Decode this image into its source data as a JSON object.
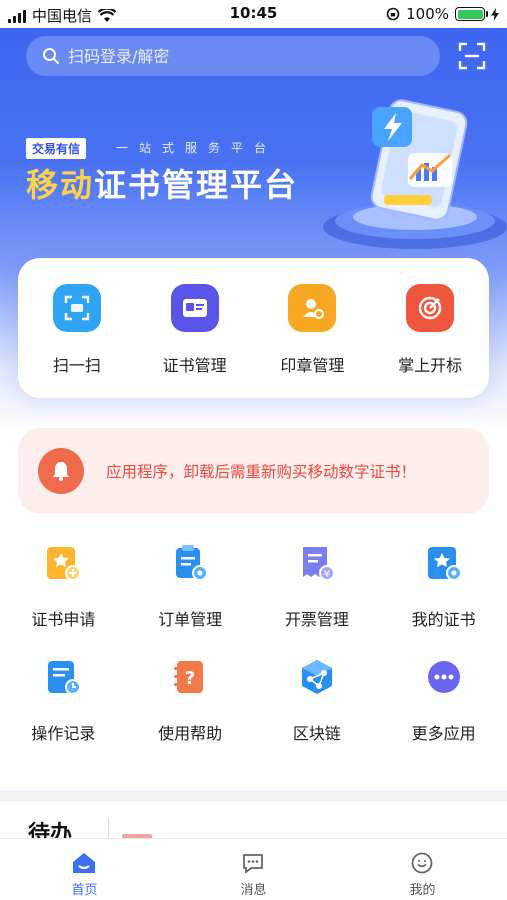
{
  "status_bar": {
    "carrier": "中国电信",
    "time": "10:45",
    "battery": "100%",
    "battery_level": 1.0
  },
  "search": {
    "placeholder": "扫码登录/解密",
    "icon": "search-icon",
    "scan_icon": "scan-icon"
  },
  "hero": {
    "badge": "交易有信",
    "tagline": "一站式服务平台",
    "title_highlight": "移动",
    "title_rest": "证书管理平台"
  },
  "quick_actions": [
    {
      "label": "扫一扫",
      "icon": "scan-icon",
      "color": "#2fa4f5"
    },
    {
      "label": "证书管理",
      "icon": "certificate-icon",
      "color": "#5a55e8"
    },
    {
      "label": "印章管理",
      "icon": "seal-icon",
      "color": "#f7a822"
    },
    {
      "label": "掌上开标",
      "icon": "target-icon",
      "color": "#f0563e"
    }
  ],
  "notice": {
    "text": "应用程序，卸载后需重新购买移动数字证书！",
    "icon": "bell-icon"
  },
  "grid": [
    {
      "label": "证书申请",
      "icon": "certificate-apply-icon"
    },
    {
      "label": "订单管理",
      "icon": "order-icon"
    },
    {
      "label": "开票管理",
      "icon": "invoice-icon"
    },
    {
      "label": "我的证书",
      "icon": "my-certificate-icon"
    },
    {
      "label": "操作记录",
      "icon": "history-icon"
    },
    {
      "label": "使用帮助",
      "icon": "help-icon"
    },
    {
      "label": "区块链",
      "icon": "blockchain-icon"
    },
    {
      "label": "更多应用",
      "icon": "more-icon"
    }
  ],
  "todo": {
    "title": "待办"
  },
  "tabbar": [
    {
      "label": "首页",
      "icon": "home-icon",
      "active": true
    },
    {
      "label": "消息",
      "icon": "message-icon",
      "active": false
    },
    {
      "label": "我的",
      "icon": "profile-icon",
      "active": false
    }
  ],
  "colors": {
    "primary": "#3b63f0",
    "accent_yellow": "#ffd24a",
    "notice_red": "#e84a3d",
    "tab_active": "#3a6ff2"
  }
}
